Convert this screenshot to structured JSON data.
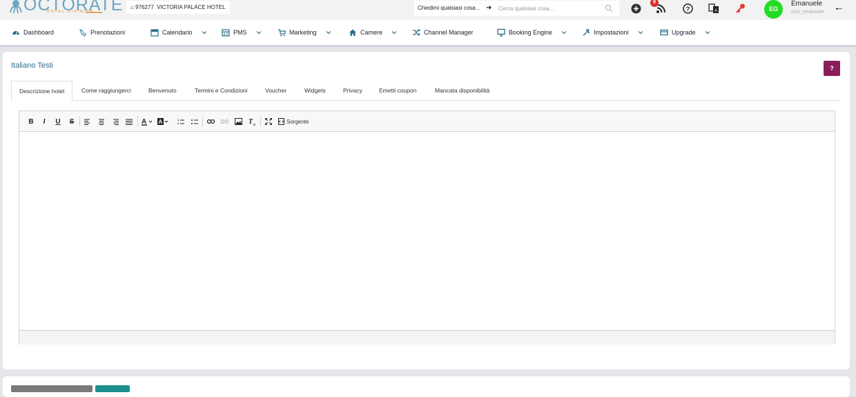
{
  "app": {
    "logo_text": "OCTORATE",
    "logo_subtitle": "HOTEL DIVISION"
  },
  "topbar": {
    "hotel_id": "976277",
    "hotel_name": "VICTORIA PALACE HOTEL",
    "ask_label": "Chiedimi qualsiasi cosa...",
    "search_placeholder": "Cerca qualsiasi cosa...",
    "notification_count": "9",
    "user_initials": "EG",
    "user_name": "Emanuele",
    "user_handle": "octo_emanuele"
  },
  "nav": {
    "items": [
      {
        "label": "Dashboard",
        "icon": "dashboard-icon",
        "dropdown": false
      },
      {
        "label": "Prenotazioni",
        "icon": "booking-icon",
        "dropdown": false
      },
      {
        "label": "Calendario",
        "icon": "calendar-icon",
        "dropdown": true
      },
      {
        "label": "PMS",
        "icon": "pms-icon",
        "dropdown": true
      },
      {
        "label": "Marketing",
        "icon": "cart-icon",
        "dropdown": true
      },
      {
        "label": "Camere",
        "icon": "home-icon",
        "dropdown": true
      },
      {
        "label": "Channel Manager",
        "icon": "shuffle-icon",
        "dropdown": false
      },
      {
        "label": "Booking Engine",
        "icon": "monitor-icon",
        "dropdown": true
      },
      {
        "label": "Impostazioni",
        "icon": "wrench-icon",
        "dropdown": true
      },
      {
        "label": "Upgrade",
        "icon": "card-icon",
        "dropdown": true
      }
    ]
  },
  "panel": {
    "title": "Italiano Testi",
    "help_label": "?",
    "tabs": [
      {
        "label": "Descrizione hotel",
        "active": true
      },
      {
        "label": "Come raggiungerci",
        "active": false
      },
      {
        "label": "Benvenuto",
        "active": false
      },
      {
        "label": "Termini e Condizioni",
        "active": false
      },
      {
        "label": "Voucher",
        "active": false
      },
      {
        "label": "Widgets",
        "active": false
      },
      {
        "label": "Privacy",
        "active": false
      },
      {
        "label": "Emetti coupon",
        "active": false
      },
      {
        "label": "Mancata disponibilità",
        "active": false
      }
    ]
  },
  "editor": {
    "source_label": "Sorgente",
    "content": ""
  },
  "colors": {
    "accent_teal": "#2c6d8a",
    "help_button": "#8a1e5b",
    "avatar": "#22dd22",
    "badge": "#e02b2b"
  }
}
